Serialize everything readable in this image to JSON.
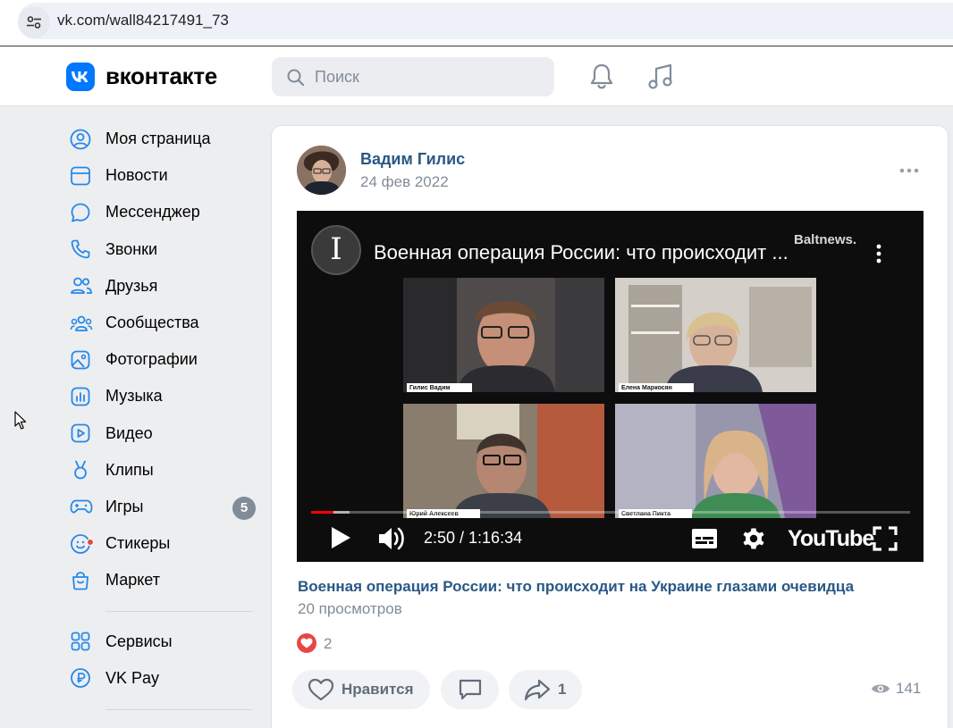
{
  "browser": {
    "url": "vk.com/wall84217491_73"
  },
  "header": {
    "brand": "вконтакте",
    "search_placeholder": "Поиск"
  },
  "sidebar": {
    "items": [
      {
        "label": "Моя страница",
        "icon": "user-circle-icon"
      },
      {
        "label": "Новости",
        "icon": "news-icon"
      },
      {
        "label": "Мессенджер",
        "icon": "message-icon"
      },
      {
        "label": "Звонки",
        "icon": "phone-icon"
      },
      {
        "label": "Друзья",
        "icon": "friends-icon"
      },
      {
        "label": "Сообщества",
        "icon": "communities-icon"
      },
      {
        "label": "Фотографии",
        "icon": "photo-icon"
      },
      {
        "label": "Музыка",
        "icon": "music-icon"
      },
      {
        "label": "Видео",
        "icon": "video-icon"
      },
      {
        "label": "Клипы",
        "icon": "clips-icon"
      },
      {
        "label": "Игры",
        "icon": "gamepad-icon",
        "badge": "5"
      },
      {
        "label": "Стикеры",
        "icon": "sticker-icon"
      },
      {
        "label": "Маркет",
        "icon": "market-icon"
      }
    ],
    "secondary": [
      {
        "label": "Сервисы",
        "icon": "services-icon"
      },
      {
        "label": "VK Pay",
        "icon": "vkpay-icon"
      }
    ]
  },
  "post": {
    "author": "Вадим Гилис",
    "date": "24 фев 2022",
    "video": {
      "title": "Военная операция России: что происходит ...",
      "channel_mark": "Baltnews.",
      "time": "2:50 / 1:16:34",
      "player_brand": "YouTube",
      "progress": 0.037,
      "buffered": 0.064,
      "participants": [
        "Гилис Вадим",
        "Елена Маркосян",
        "Юрий Алексеев",
        "Светлана Пикта"
      ]
    },
    "link_title": "Военная операция России: что происходит на Украине глазами очевидца",
    "views_label": "20 просмотров",
    "reactions_count": "2",
    "like_label": "Нравится",
    "share_count": "1",
    "view_count": "141"
  },
  "colors": {
    "accent": "#0077ff",
    "link": "#2a5885",
    "muted": "#818c99",
    "like": "#e64646"
  }
}
